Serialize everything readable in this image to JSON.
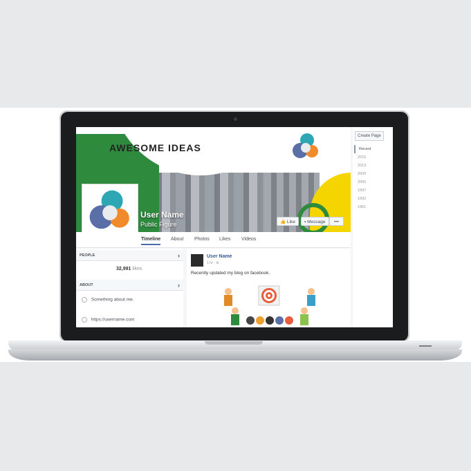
{
  "cover": {
    "title": "AWESOME IDEAS"
  },
  "profile": {
    "name": "User Name",
    "category": "Public Figure"
  },
  "buttons": {
    "like": "Like",
    "message": "Message",
    "more": "•••"
  },
  "tabs": [
    "Timeline",
    "About",
    "Photos",
    "Likes",
    "Videos"
  ],
  "right_sidebar": {
    "create_page": "Create Page",
    "years": [
      "Recent",
      "2015",
      "2013",
      "2009",
      "2005",
      "1997",
      "1992",
      "1961"
    ]
  },
  "people": {
    "heading": "PEOPLE",
    "likes_count": "32,991",
    "likes_label": "likes"
  },
  "about": {
    "heading": "ABOUT",
    "description": "Something about me.",
    "website": "https://username.com"
  },
  "post": {
    "author": "User Name",
    "time": "1 hr · ⚙",
    "text": "Recently updated my blog on facebook."
  },
  "colors": {
    "green": "#2e8b3e",
    "yellow": "#f5d500",
    "link_blue": "#365899"
  }
}
